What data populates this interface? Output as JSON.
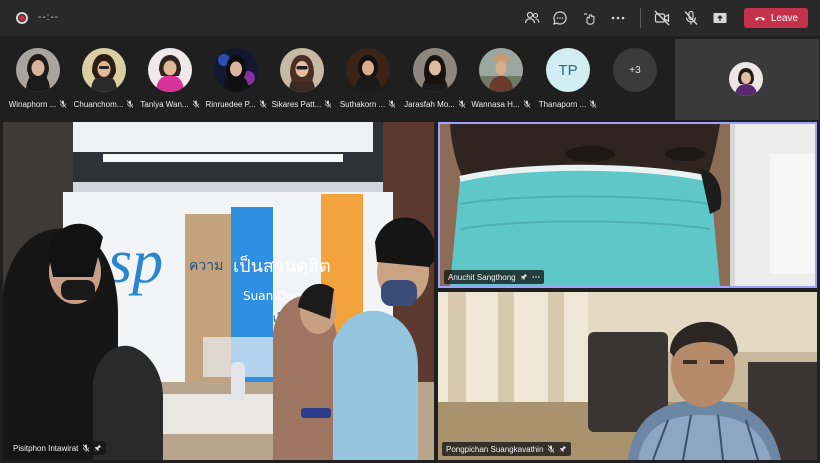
{
  "topbar": {
    "timer": "--:--",
    "leave_label": "Leave",
    "icons": [
      "record-icon",
      "people-icon",
      "chat-icon",
      "reactions-icon",
      "more-icon",
      "camera-off-icon",
      "mic-off-icon",
      "share-icon",
      "phone-hangup-icon"
    ],
    "colors": {
      "leave": "#c4314b",
      "bar": "#292929"
    }
  },
  "participants": [
    {
      "name": "Winaphorn ..."
    },
    {
      "name": "Chuanchom..."
    },
    {
      "name": "Taniya Wan..."
    },
    {
      "name": "Rinruedee P..."
    },
    {
      "name": "Sikares Patt..."
    },
    {
      "name": "Suthakorn ..."
    },
    {
      "name": "Jarasfah Mo..."
    },
    {
      "name": "Wannasa H..."
    },
    {
      "name": "Thanaporn ...",
      "initials": "TP"
    }
  ],
  "overflow_count": "+3",
  "tiles": {
    "main": {
      "name": "Pisitphon Intawirat"
    },
    "speaker_top": {
      "name": "Anuchit Sangthong"
    },
    "speaker_bottom": {
      "name": "Pongpichan Suangkavathin"
    }
  },
  "poster_text": {
    "line1": "ความ",
    "line2": "เป็นสวนดุสิต",
    "line3": "Suan Dus",
    "line4": "เป็นผู้น"
  }
}
